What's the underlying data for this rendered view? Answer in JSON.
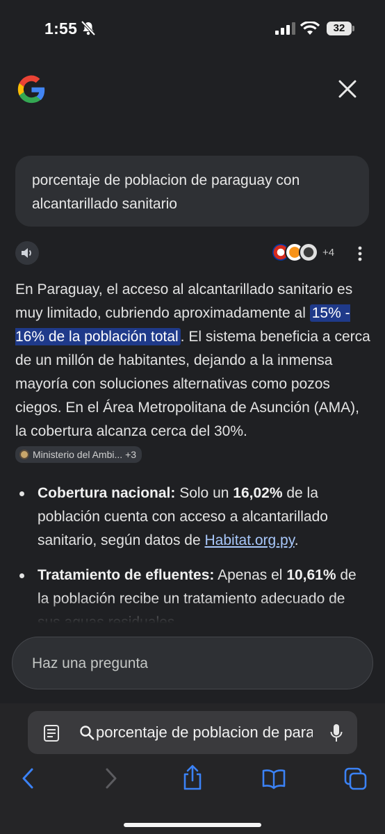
{
  "status": {
    "time": "1:55",
    "battery": "32"
  },
  "query": "porcentaje de poblacion de paraguay con alcantarillado sanitario",
  "sources": {
    "more": "+4"
  },
  "answer": {
    "p1": "En Paraguay, el acceso al alcantarillado sanitario es muy limitado, cubriendo aproximadamente al ",
    "highlight": "15% - 16% de la población total",
    "p2": ". El sistema beneficia a cerca de un millón de habitantes, dejando a la inmensa mayoría con soluciones alternativas como pozos ciegos. En el Área Metropolitana de Asunción (AMA), la cobertura alcanza cerca del 30%. ",
    "chip_label": "Ministerio del Ambi...",
    "chip_more": "+3"
  },
  "bullets": [
    {
      "title": "Cobertura nacional:",
      "t1": " Solo un ",
      "num": "16,02%",
      "t2": " de la población cuenta con acceso a alcantarillado sanitario, según datos de ",
      "link": "Habitat.org.py",
      "t3": "."
    },
    {
      "title": "Tratamiento de efluentes:",
      "t1": " Apenas el ",
      "num": "10,61%",
      "t2": " de la población recibe un tratamiento adecuado de sus aguas residuales."
    }
  ],
  "ask_placeholder": "Haz una pregunta",
  "safari": {
    "url_text": "porcentaje de poblacion de paraguay con alcantarillado sanitario"
  },
  "icons": [
    "bell-slash-icon",
    "signal-icon",
    "wifi-icon",
    "google-logo",
    "close-icon",
    "speaker-icon",
    "more-icon",
    "search-icon",
    "reader-icon",
    "mic-icon",
    "back-icon",
    "forward-icon",
    "share-icon",
    "bookmarks-icon",
    "tabs-icon"
  ]
}
